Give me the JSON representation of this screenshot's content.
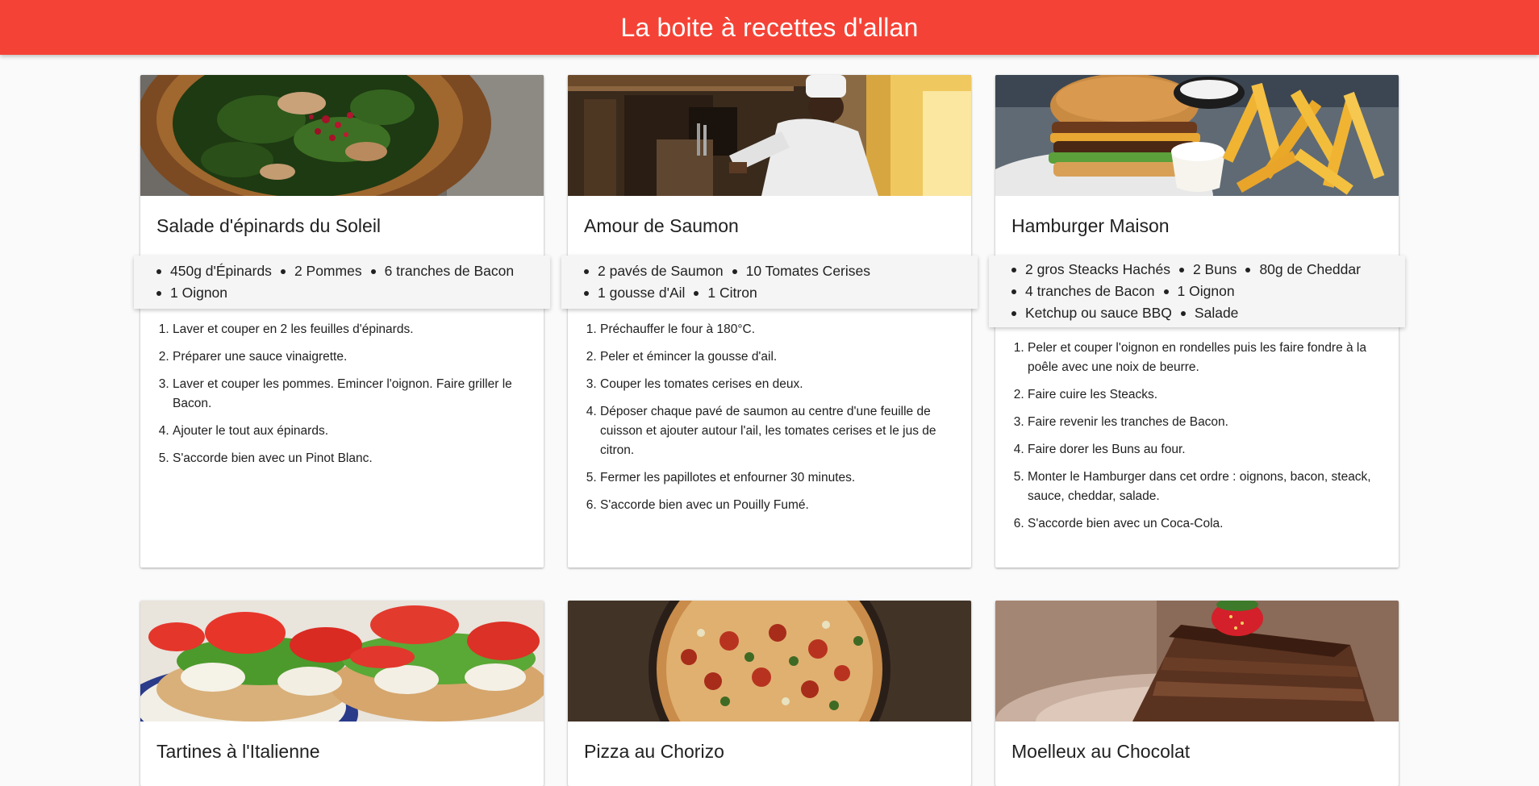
{
  "app": {
    "title": "La boite à recettes d'allan"
  },
  "recipes": [
    {
      "title": "Salade d'épinards du Soleil",
      "image": "salad-photo",
      "ingredients": [
        "450g d'Épinards",
        "2 Pommes",
        "6 tranches de Bacon",
        "1 Oignon"
      ],
      "steps": [
        "Laver et couper en 2 les feuilles d'épinards.",
        "Préparer une sauce vinaigrette.",
        "Laver et couper les pommes. Emincer l'oignon. Faire griller le Bacon.",
        "Ajouter le tout aux épinards.",
        "S'accorde bien avec un Pinot Blanc."
      ]
    },
    {
      "title": "Amour de Saumon",
      "image": "chef-photo",
      "ingredients": [
        "2 pavés de Saumon",
        "10 Tomates Cerises",
        "1 gousse d'Ail",
        "1 Citron"
      ],
      "steps": [
        "Préchauffer le four à 180°C.",
        "Peler et émincer la gousse d'ail.",
        "Couper les tomates cerises en deux.",
        "Déposer chaque pavé de saumon au centre d'une feuille de cuisson et ajouter autour l'ail, les tomates cerises et le jus de citron.",
        "Fermer les papillotes et enfourner 30 minutes.",
        "S'accorde bien avec un Pouilly Fumé."
      ]
    },
    {
      "title": "Hamburger Maison",
      "image": "burger-photo",
      "ingredients": [
        "2 gros Steacks Hachés",
        "2 Buns",
        "80g de Cheddar",
        "4 tranches de Bacon",
        "1 Oignon",
        "Ketchup ou sauce BBQ",
        "Salade"
      ],
      "steps": [
        "Peler et couper l'oignon en rondelles puis les faire fondre à la poêle avec une noix de beurre.",
        "Faire cuire les Steacks.",
        "Faire revenir les tranches de Bacon.",
        "Faire dorer les Buns au four.",
        "Monter le Hamburger dans cet ordre : oignons, bacon, steack, sauce, cheddar, salade.",
        "S'accorde bien avec un Coca-Cola."
      ]
    },
    {
      "title": "Tartines à l'Italienne",
      "image": "tartines-photo"
    },
    {
      "title": "Pizza au Chorizo",
      "image": "pizza-photo"
    },
    {
      "title": "Moelleux au Chocolat",
      "image": "chocolate-cake-photo"
    }
  ]
}
